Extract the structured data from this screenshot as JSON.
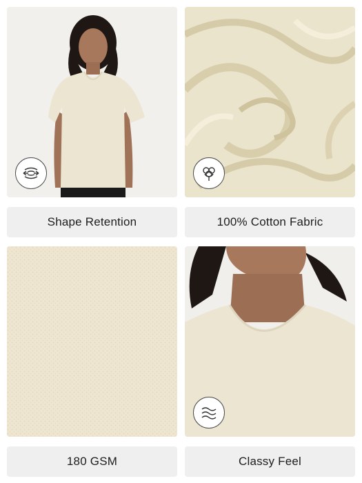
{
  "features": [
    {
      "label": "Shape Retention",
      "icon": "stretch-arrows-icon"
    },
    {
      "label": "100% Cotton Fabric",
      "icon": "cotton-flower-icon"
    },
    {
      "label": "180 GSM",
      "icon": ""
    },
    {
      "label": "Classy Feel",
      "icon": "waves-icon"
    }
  ],
  "colors": {
    "fabric": "#ebe4cc",
    "label_bg": "#efefef",
    "text": "#1c1c1c"
  }
}
